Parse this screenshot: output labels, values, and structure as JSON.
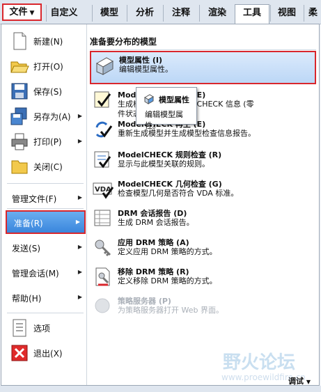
{
  "ribbon": {
    "file_tab": "文件",
    "tabs": [
      {
        "label": "自定义"
      },
      {
        "label": "模型"
      },
      {
        "label": "分析"
      },
      {
        "label": "注释"
      },
      {
        "label": "渲染"
      },
      {
        "label": "工具"
      },
      {
        "label": "视图"
      },
      {
        "label": "柔"
      }
    ],
    "active_tab": "工具"
  },
  "file_menu": {
    "items": [
      {
        "label": "新建",
        "key": "(N)"
      },
      {
        "label": "打开",
        "key": "(O)"
      },
      {
        "label": "保存",
        "key": "(S)"
      },
      {
        "label": "另存为",
        "key": "(A)"
      },
      {
        "label": "打印",
        "key": "(P)"
      },
      {
        "label": "关闭",
        "key": "(C)"
      },
      {
        "label": "管理文件",
        "key": "(F)"
      },
      {
        "label": "准备",
        "key": "(R)"
      },
      {
        "label": "发送",
        "key": "(S)"
      },
      {
        "label": "管理会话",
        "key": "(M)"
      },
      {
        "label": "帮助",
        "key": "(H)"
      },
      {
        "label": "选项",
        "key": ""
      },
      {
        "label": "退出",
        "key": "(X)"
      }
    ],
    "submenu_arrow": "▶"
  },
  "prepare_panel": {
    "heading": "准备要分布的模型",
    "items": [
      {
        "title": "模型属性 (I)",
        "desc": "编辑模型属性。"
      },
      {
        "title": "ModelCHECK 再生 (E)",
        "desc": "生成模型关联的 ModelCHECK 信息 (零件状态)。"
      },
      {
        "title": "ModelCHECK 再生 (E)",
        "desc": "重新生成模型并生成模型检查信息报告。"
      },
      {
        "title": "ModelCHECK 规则检查 (R)",
        "desc": "显示与此模型关联的规则。"
      },
      {
        "title": "ModelCHECK 几何检查 (G)",
        "desc": "检查模型几何是否符合 VDA 标准。"
      },
      {
        "title": "DRM 会话报告 (D)",
        "desc": "生成 DRM 会话报告。"
      },
      {
        "title": "应用 DRM 策略 (A)",
        "desc": "定义应用 DRM 策略的方式。"
      },
      {
        "title": "移除 DRM 策略 (R)",
        "desc": "定义移除 DRM 策略的方式。"
      },
      {
        "title": "策略服务器 (P)",
        "desc": "为策略服务器打开 Web 界面。"
      }
    ]
  },
  "tooltip": {
    "title": "模型属性",
    "desc": "编辑模型属性。"
  },
  "status": {
    "debug_label": "调试",
    "watermark": "野火论坛",
    "watermark_url": "www.proewildfire.cn"
  },
  "colors": {
    "highlight_border": "#d9262c",
    "selected_bg": "#3a86dc"
  }
}
